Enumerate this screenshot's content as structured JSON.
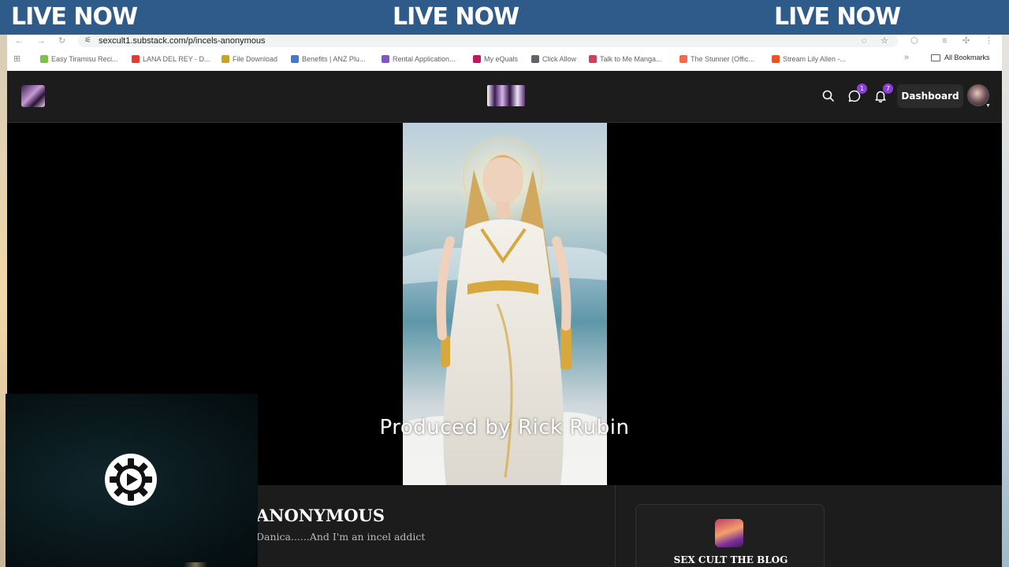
{
  "banner": {
    "left": "LIVE NOW",
    "center": "LIVE NOW",
    "right": "LIVE NOW"
  },
  "browser": {
    "url": "sexcult1.substack.com/p/incels-anonymous",
    "bookmarks": [
      {
        "label": "Easy Tiramisu Reci...",
        "color": "#7cc24a"
      },
      {
        "label": "LANA DEL REY - D...",
        "color": "#e53935"
      },
      {
        "label": "File Download",
        "color": "#c9a227"
      },
      {
        "label": "Benefits | ANZ Plu...",
        "color": "#4a78c9"
      },
      {
        "label": "Rental Application...",
        "color": "#7e57c2"
      },
      {
        "label": "My eQuals",
        "color": "#c2185b"
      },
      {
        "label": "Click Allow",
        "color": "#5f6368"
      },
      {
        "label": "Talk to Me Manga...",
        "color": "#d1405e"
      },
      {
        "label": "The Stunner (Offic...",
        "color": "#ef6c4a"
      },
      {
        "label": "Stream Lily Allen -...",
        "color": "#f4511e"
      }
    ],
    "all_bookmarks_label": "All Bookmarks"
  },
  "header": {
    "chat_badge": "1",
    "notif_badge": "7",
    "dashboard_label": "Dashboard"
  },
  "video": {
    "caption": "Produced by Rick Rubin"
  },
  "post": {
    "title": "ANONYMOUS",
    "subtitle": "Danica......And I'm an incel addict"
  },
  "publication": {
    "name": "SEX CULT THE BLOG"
  },
  "colors": {
    "banner": "#2f5b8a",
    "badge": "#8b3fd9",
    "page_bg": "#1c1c1c"
  }
}
